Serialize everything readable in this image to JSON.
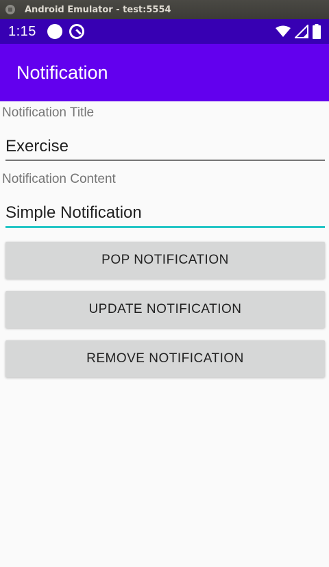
{
  "window": {
    "title": "Android Emulator - test:5554"
  },
  "status_bar": {
    "time": "1:15",
    "icons": [
      "circle-notification-icon",
      "sync-icon",
      "wifi-icon",
      "signal-icon",
      "battery-icon"
    ]
  },
  "app_bar": {
    "title": "Notification"
  },
  "form": {
    "title_label": "Notification Title",
    "title_value": "Exercise",
    "content_label": "Notification Content",
    "content_value": "Simple Notification"
  },
  "buttons": {
    "pop": "POP NOTIFICATION",
    "update": "UPDATE NOTIFICATION",
    "remove": "REMOVE NOTIFICATION"
  },
  "colors": {
    "status_bar": "#3700b3",
    "app_bar": "#6200ee",
    "focus_underline": "#26c6c6",
    "button_bg": "#d6d7d7"
  }
}
